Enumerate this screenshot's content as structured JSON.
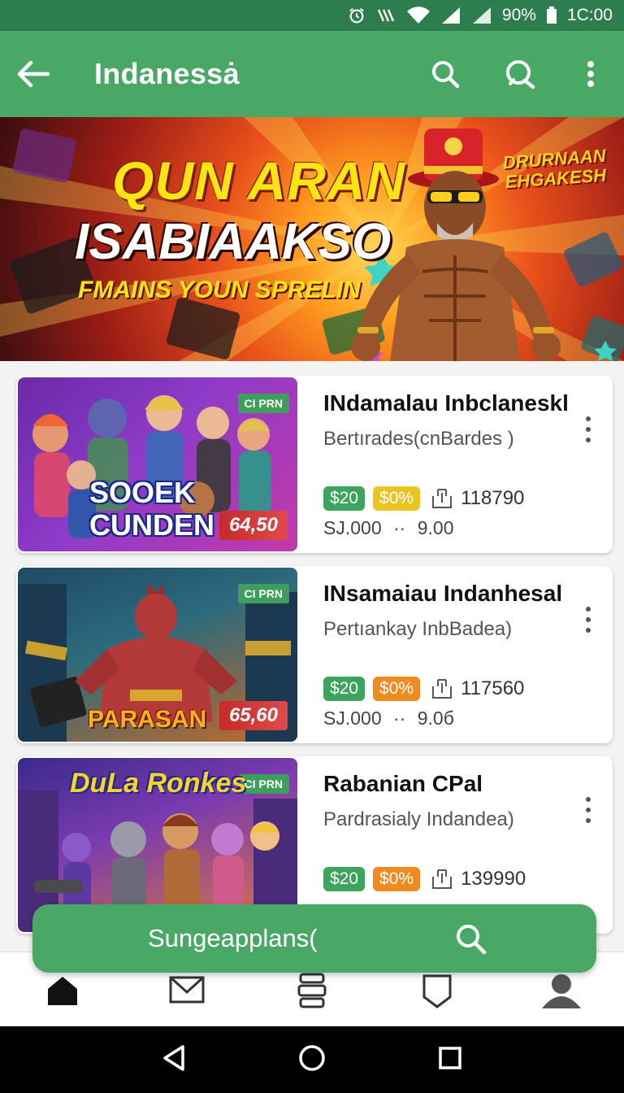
{
  "status_bar": {
    "battery": "90%",
    "time": "1C:00"
  },
  "app_bar": {
    "title": "Indanessȧ"
  },
  "banner": {
    "headline_1": "QUN ARAN",
    "headline_2": "ISABIAAKSO",
    "headline_3": "FMAINS YOUN SPRELIN",
    "badge_text": "DRURNAAN EHGAKESH"
  },
  "games": [
    {
      "thumb_tag": "CI PRN",
      "thumb_title": "SOOEK CUNDEN",
      "thumb_price": "64,50",
      "name": "INdamalau Inbclaneskl",
      "subtitle": "Bertırades(cnBardes )",
      "price_pill": "$20",
      "discount_pill": "$0%",
      "stat": "118790",
      "meta_left": "SJ.000",
      "meta_sep": "··",
      "meta_right": "9.00"
    },
    {
      "thumb_tag": "CI PRN",
      "thumb_title": "PARASAN",
      "thumb_price": "65,60",
      "name": "INsamaiau Indanhesal",
      "subtitle": "Pertıankay InbBadea)",
      "price_pill": "$20",
      "discount_pill": "$0%",
      "stat": "117560",
      "meta_left": "SJ.000",
      "meta_sep": "··",
      "meta_right": "9.0б"
    },
    {
      "thumb_tag": "CI PRN",
      "thumb_title": "DuLa Ronkes",
      "name": "Rabanian CPal",
      "subtitle": "Pardrasialy Indandea)",
      "price_pill": "$20",
      "discount_pill": "$0%",
      "stat": "139990"
    }
  ],
  "floating_search": {
    "label": "Sungeapplans("
  },
  "bottom_nav": {
    "items": [
      "home-icon",
      "inbox-icon",
      "library-icon",
      "badge-icon",
      "profile-icon"
    ],
    "active": "home-icon"
  },
  "colors": {
    "primary": "#4aa866",
    "status_bar": "#2e7d4f",
    "pill_green": "#3ea35c",
    "pill_yellow": "#e9c422",
    "pill_orange": "#ee8a1e"
  }
}
